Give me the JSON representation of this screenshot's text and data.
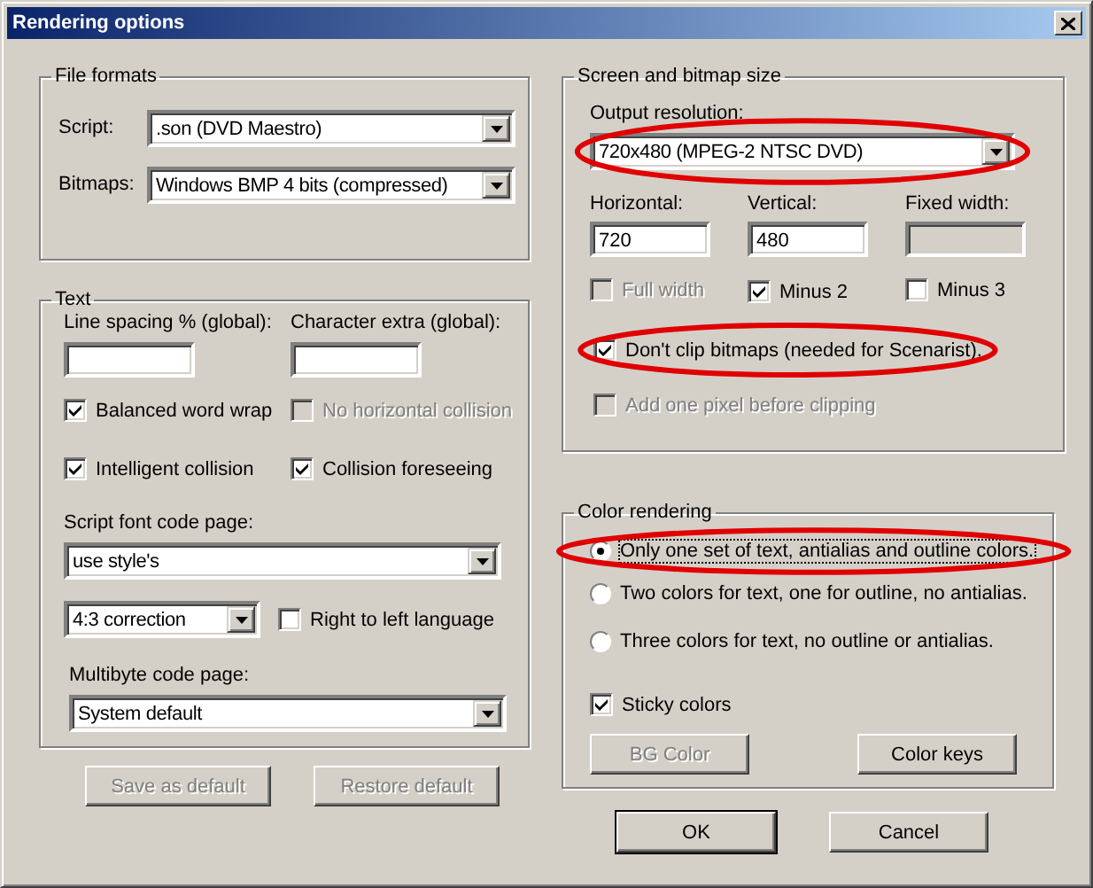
{
  "window": {
    "title": "Rendering options"
  },
  "file_formats": {
    "title": "File formats",
    "fields": [
      {
        "label": "Script:",
        "value": ".son (DVD Maestro)"
      },
      {
        "label": "Bitmaps:",
        "value": "Windows BMP 4 bits (compressed)"
      }
    ]
  },
  "text": {
    "title": "Text",
    "inputs": [
      {
        "label": "Line spacing % (global):"
      },
      {
        "label": "Character extra (global):"
      }
    ],
    "checkboxes": [
      {
        "label": "Balanced word wrap",
        "checked": true,
        "disabled": false
      },
      {
        "label": "No horizontal collision",
        "checked": false,
        "disabled": true
      },
      {
        "label": "Intelligent collision",
        "checked": true,
        "disabled": false
      },
      {
        "label": "Collision foreseeing",
        "checked": true,
        "disabled": false
      }
    ],
    "script_font_code_page": {
      "label": "Script font code page:",
      "value": "use style's"
    },
    "correction": {
      "value": "4:3 correction"
    },
    "right_to_left": {
      "label": "Right to left language",
      "checked": false,
      "disabled": false
    },
    "multibyte_code_page": {
      "label": "Multibyte code page:",
      "value": "System default"
    }
  },
  "left_buttons": [
    {
      "label": "Save as default",
      "disabled": true
    },
    {
      "label": "Restore default",
      "disabled": true
    }
  ],
  "screen": {
    "title": "Screen and bitmap size",
    "output_resolution": {
      "label": "Output resolution:",
      "value": "720x480 (MPEG-2 NTSC DVD)",
      "circled": true
    },
    "sizes": [
      {
        "label": "Horizontal:",
        "value": "720",
        "disabled": false
      },
      {
        "label": "Vertical:",
        "value": "480",
        "disabled": false
      },
      {
        "label": "Fixed width:",
        "disabled": true
      }
    ],
    "size_checks": [
      {
        "label": "Full width",
        "checked": false,
        "disabled": true
      },
      {
        "label": "Minus 2",
        "checked": true,
        "disabled": false
      },
      {
        "label": "Minus 3",
        "checked": false,
        "disabled": false
      }
    ],
    "dont_clip": {
      "label": "Don't clip bitmaps (needed for Scenarist).",
      "checked": true,
      "disabled": false,
      "circled": true
    },
    "add_pixel": {
      "label": "Add one pixel before clipping",
      "checked": false,
      "disabled": true
    }
  },
  "color": {
    "title": "Color rendering",
    "modes": [
      {
        "label": "Only one set of text, antialias and outline colors.",
        "selected": true,
        "circled": true
      },
      {
        "label": "Two colors for text, one for outline, no antialias.",
        "selected": false,
        "circled": false
      },
      {
        "label": "Three colors for text, no outline or antialias.",
        "selected": false,
        "circled": false
      }
    ],
    "sticky": {
      "label": "Sticky colors",
      "checked": true,
      "disabled": false
    },
    "buttons": [
      {
        "label": "BG Color",
        "disabled": true
      },
      {
        "label": "Color keys",
        "disabled": false
      }
    ]
  },
  "dialog_buttons": [
    {
      "label": "OK",
      "default": true
    },
    {
      "label": "Cancel",
      "default": false
    }
  ]
}
